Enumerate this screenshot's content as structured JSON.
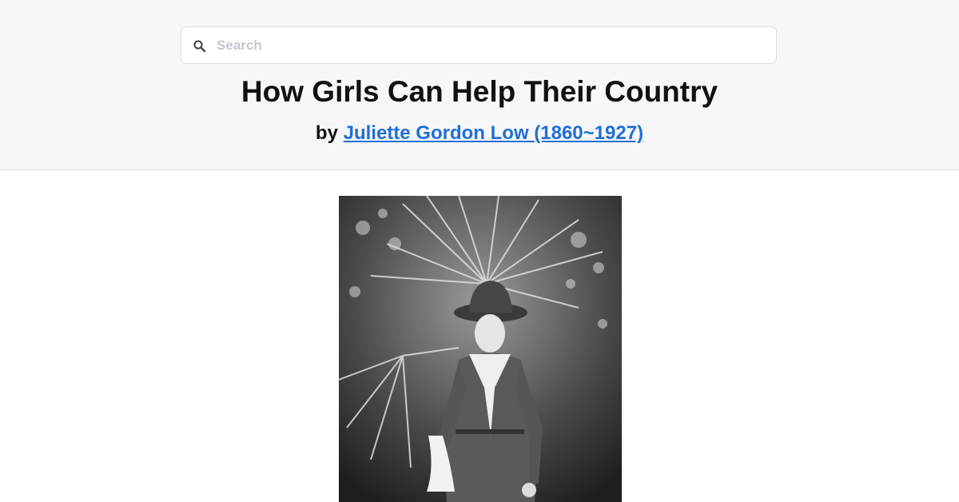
{
  "search": {
    "placeholder": "Search",
    "icon": "search-icon"
  },
  "book": {
    "title": "How Girls Can Help Their Country",
    "by_label": "by",
    "author_link": "Juliette Gordon Low (1860~1927)"
  },
  "colors": {
    "header_bg": "#f6f7f9",
    "link": "#1f6fd6",
    "title_text": "#111111"
  },
  "photo": {
    "subject": "black-and-white portrait of a woman in Girl Scout uniform with a wide-brimmed hat and neckerchief, standing in front of palm fronds"
  }
}
